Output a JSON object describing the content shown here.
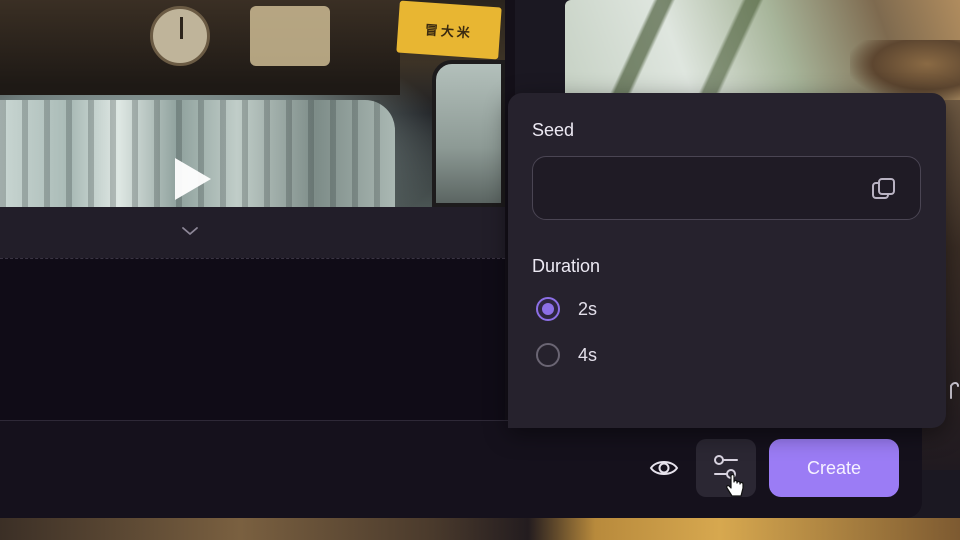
{
  "toolbar": {
    "create_label": "Create",
    "visibility_icon": "eye-icon",
    "settings_icon": "sliders-icon"
  },
  "video_preview": {
    "play_icon": "play-icon",
    "expand_icon": "chevron-down-icon",
    "sign_text": "冒大米"
  },
  "settings_panel": {
    "seed": {
      "label": "Seed",
      "value": "",
      "placeholder": "",
      "copy_icon": "copy-icon"
    },
    "duration": {
      "label": "Duration",
      "options": [
        {
          "label": "2s",
          "selected": true
        },
        {
          "label": "4s",
          "selected": false
        }
      ]
    }
  },
  "colors": {
    "accent": "#9b7cf5",
    "radio_selected": "#8c6fe6",
    "panel_bg": "#26222d",
    "app_bg": "#100c17"
  }
}
